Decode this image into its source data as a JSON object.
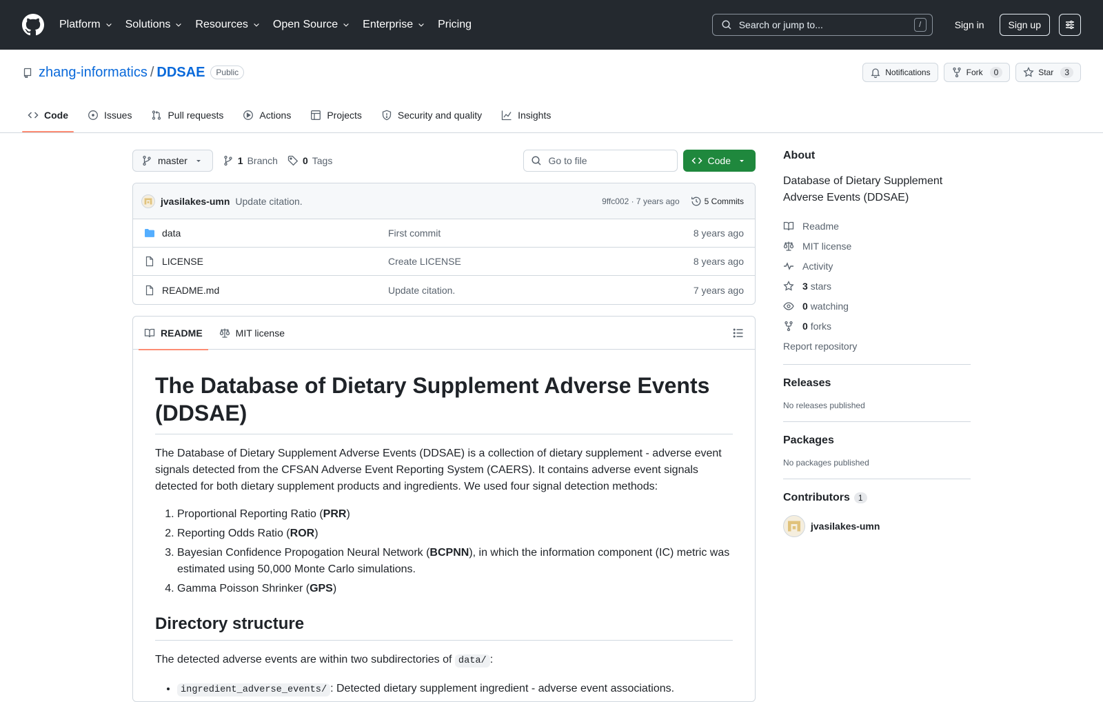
{
  "header": {
    "nav": [
      {
        "label": "Platform",
        "dropdown": true
      },
      {
        "label": "Solutions",
        "dropdown": true
      },
      {
        "label": "Resources",
        "dropdown": true
      },
      {
        "label": "Open Source",
        "dropdown": true
      },
      {
        "label": "Enterprise",
        "dropdown": true
      },
      {
        "label": "Pricing",
        "dropdown": false
      }
    ],
    "search_placeholder": "Search or jump to...",
    "search_shortcut": "/",
    "sign_in": "Sign in",
    "sign_up": "Sign up"
  },
  "repo": {
    "owner": "zhang-informatics",
    "separator": "/",
    "name": "DDSAE",
    "visibility": "Public",
    "notifications_label": "Notifications",
    "fork_label": "Fork",
    "fork_count": "0",
    "star_label": "Star",
    "star_count": "3"
  },
  "tabs": [
    {
      "label": "Code",
      "icon": "code-icon",
      "active": true
    },
    {
      "label": "Issues",
      "icon": "issue-icon",
      "active": false
    },
    {
      "label": "Pull requests",
      "icon": "pull-request-icon",
      "active": false
    },
    {
      "label": "Actions",
      "icon": "play-icon",
      "active": false
    },
    {
      "label": "Projects",
      "icon": "table-icon",
      "active": false
    },
    {
      "label": "Security and quality",
      "icon": "shield-icon",
      "active": false
    },
    {
      "label": "Insights",
      "icon": "graph-icon",
      "active": false
    }
  ],
  "filenav": {
    "branch": "master",
    "branch_count": "1",
    "branch_label": "Branch",
    "tag_count": "0",
    "tag_label": "Tags",
    "goto_placeholder": "Go to file",
    "code_button": "Code"
  },
  "commit": {
    "author": "jvasilakes-umn",
    "message": "Update citation.",
    "meta": "9ffc002 · 7 years ago",
    "commits_label": "5 Commits"
  },
  "files": [
    {
      "name": "data",
      "type": "folder",
      "message": "First commit",
      "age": "8 years ago"
    },
    {
      "name": "LICENSE",
      "type": "file",
      "message": "Create LICENSE",
      "age": "8 years ago"
    },
    {
      "name": "README.md",
      "type": "file",
      "message": "Update citation.",
      "age": "7 years ago"
    }
  ],
  "readme_tabs": {
    "readme": "README",
    "license": "MIT license"
  },
  "readme": {
    "h1": "The Database of Dietary Supplement Adverse Events (DDSAE)",
    "intro": "The Database of Dietary Supplement Adverse Events (DDSAE) is a collection of dietary supplement - adverse event signals detected from the CFSAN Adverse Event Reporting System (CAERS). It contains adverse event signals detected for both dietary supplement products and ingredients. We used four signal detection methods:",
    "methods": [
      {
        "pre": "Proportional Reporting Ratio (",
        "bold": "PRR",
        "post": ")"
      },
      {
        "pre": "Reporting Odds Ratio (",
        "bold": "ROR",
        "post": ")"
      },
      {
        "pre": "Bayesian Confidence Propogation Neural Network (",
        "bold": "BCPNN",
        "post": "), in which the information component (IC) metric was estimated using 50,000 Monte Carlo simulations."
      },
      {
        "pre": "Gamma Poisson Shrinker (",
        "bold": "GPS",
        "post": ")"
      }
    ],
    "h2": "Directory structure",
    "dir_text": "The detected adverse events are within two subdirectories of",
    "dir_code": "data/",
    "dir_colon": ":",
    "bullets": [
      {
        "code": "ingredient_adverse_events/",
        "text": ": Detected dietary supplement ingredient - adverse event associations."
      }
    ]
  },
  "about": {
    "title": "About",
    "description": "Database of Dietary Supplement Adverse Events (DDSAE)",
    "readme": "Readme",
    "license": "MIT license",
    "activity": "Activity",
    "stars_count": "3",
    "stars_label": "stars",
    "watching_count": "0",
    "watching_label": "watching",
    "forks_count": "0",
    "forks_label": "forks",
    "report": "Report repository"
  },
  "releases": {
    "title": "Releases",
    "empty": "No releases published"
  },
  "packages": {
    "title": "Packages",
    "empty": "No packages published"
  },
  "contributors": {
    "title": "Contributors",
    "count": "1",
    "user": "jvasilakes-umn"
  },
  "colors": {
    "header_bg": "#24292f",
    "link": "#0969da",
    "code_btn": "#1f883d",
    "tab_underline": "#fd8c73"
  }
}
